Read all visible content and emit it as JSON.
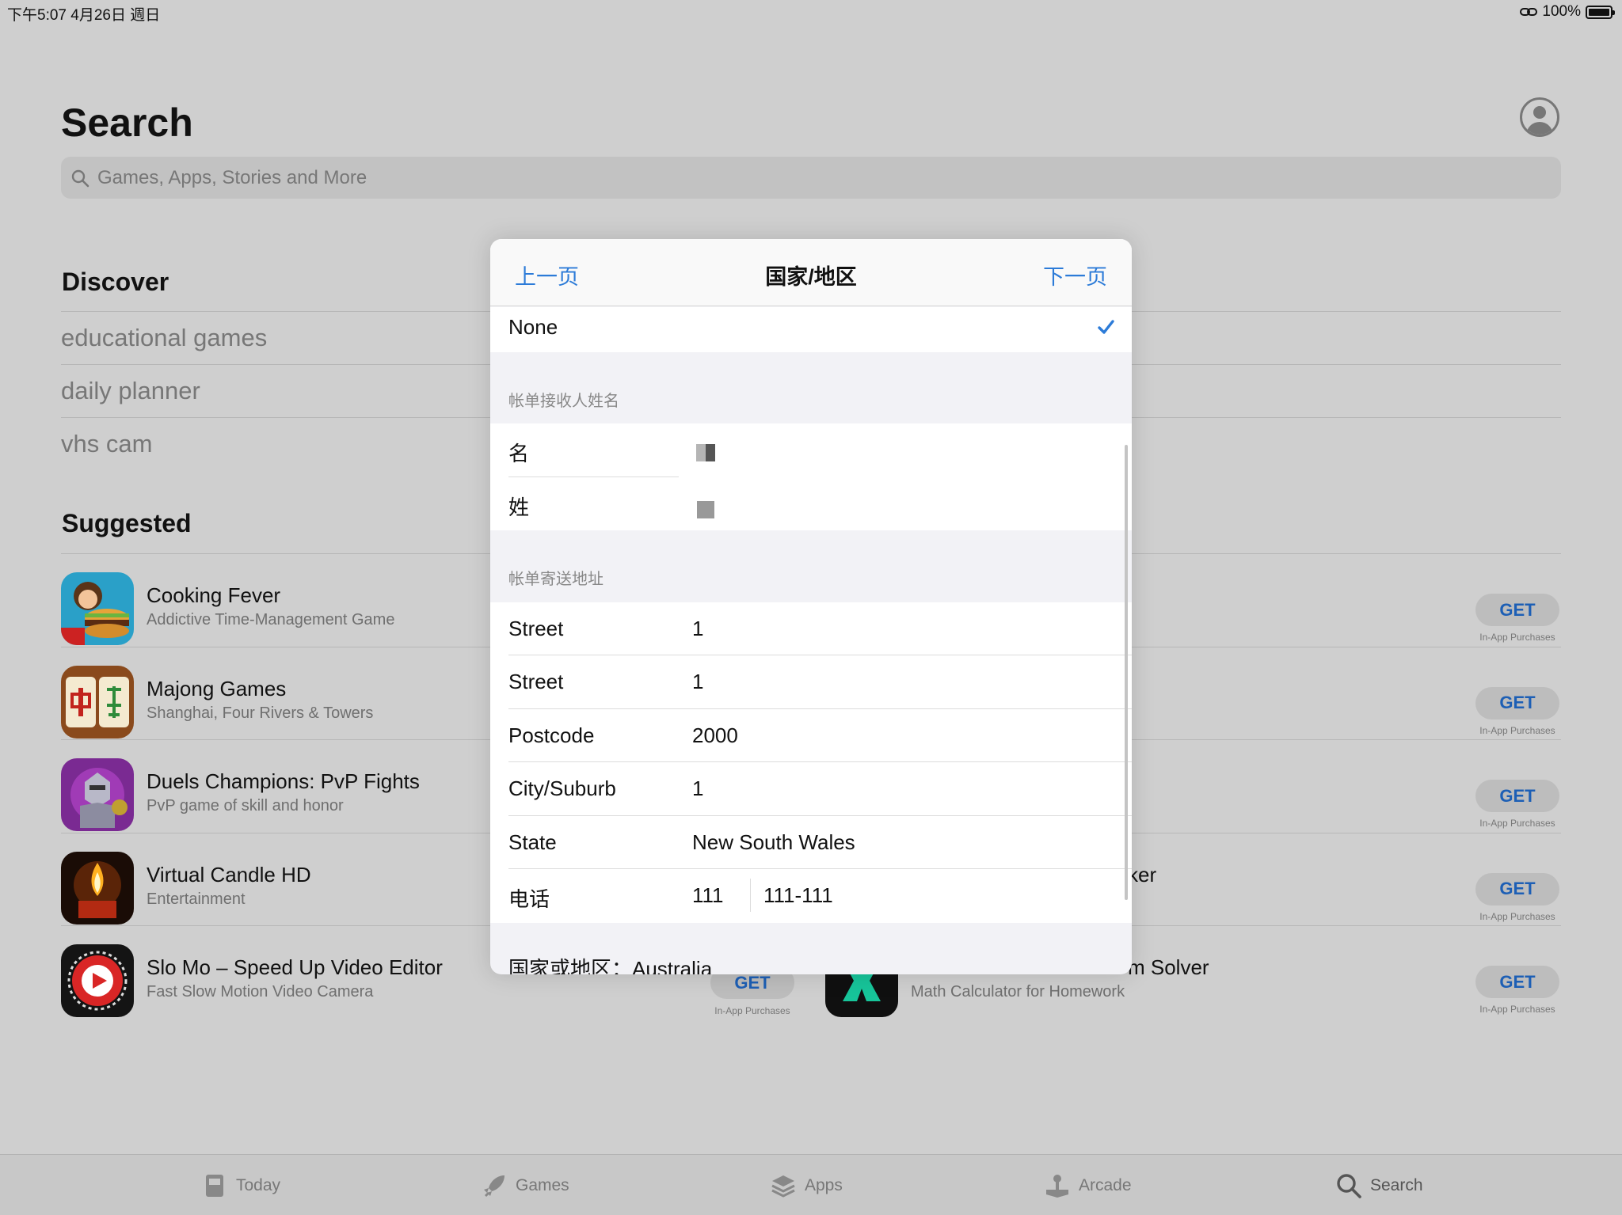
{
  "status": {
    "time_date": "下午5:07   4月26日 週日",
    "battery": "100%"
  },
  "page": {
    "title": "Search",
    "search_placeholder": "Games, Apps, Stories and More"
  },
  "discover": {
    "title": "Discover",
    "items": [
      "educational games",
      "daily planner",
      "vhs cam"
    ]
  },
  "suggested": {
    "title": "Suggested",
    "left": [
      {
        "name": "Cooking Fever",
        "sub": "Addictive Time-Management Game",
        "icon": "cooking-fever-icon"
      },
      {
        "name": "Majong Games",
        "sub": "Shanghai, Four Rivers & Towers",
        "icon": "mahjong-icon"
      },
      {
        "name": "Duels Champions: PvP Fights",
        "sub": "PvP game of skill and honor",
        "icon": "knight-icon"
      },
      {
        "name": "Virtual Candle HD",
        "sub": "Entertainment",
        "icon": "candle-icon"
      },
      {
        "name": "Slo Mo – Speed Up Video Editor",
        "sub": "Fast Slow Motion Video Camera",
        "icon": "slomo-icon"
      }
    ],
    "right_partial": {
      "row4_suffix": "ker",
      "row5_name_fragment": "m Solver",
      "row5_sub": "Math Calculator for Homework",
      "row5_icon": "snapcalc-icon"
    },
    "get_label": "GET",
    "iap_label": "In-App Purchases"
  },
  "tabs": [
    {
      "label": "Today",
      "icon": "today-icon"
    },
    {
      "label": "Games",
      "icon": "rocket-icon"
    },
    {
      "label": "Apps",
      "icon": "layers-icon"
    },
    {
      "label": "Arcade",
      "icon": "joystick-icon"
    },
    {
      "label": "Search",
      "icon": "search-icon"
    }
  ],
  "modal": {
    "back": "上一页",
    "title": "国家/地区",
    "next": "下一页",
    "selected_option": "None",
    "billing_name_header": "帐单接收人姓名",
    "first_name_label": "名",
    "last_name_label": "姓",
    "billing_address_header": "帐单寄送地址",
    "address_rows": [
      {
        "label": "Street",
        "value": "1"
      },
      {
        "label": "Street",
        "value": "1"
      },
      {
        "label": "Postcode",
        "value": "2000"
      },
      {
        "label": "City/Suburb",
        "value": "1"
      },
      {
        "label": "State",
        "value": "New South Wales"
      }
    ],
    "phone": {
      "label": "电话",
      "area": "111",
      "number": "111-111"
    },
    "country_footer": "国家或地区：Australia",
    "accent_color": "#2c7bd8"
  }
}
